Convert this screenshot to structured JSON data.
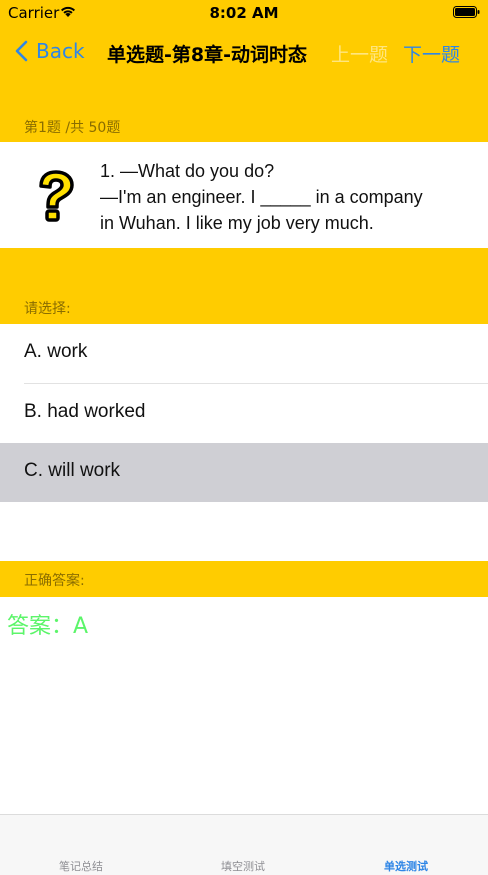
{
  "status_bar": {
    "carrier": "Carrier",
    "time": "8:02 AM"
  },
  "nav": {
    "back_label": "Back",
    "title": "单选题-第8章-动词时态",
    "prev_label": "上一题",
    "next_label": "下一题"
  },
  "progress": {
    "text": "第1题 /共 50题"
  },
  "question": {
    "lines": [
      "1. —What do you do?",
      "—I'm an engineer. I _____ in a company",
      "in Wuhan. I like my job very much."
    ]
  },
  "choose_label": "请选择:",
  "options": [
    {
      "label": "A. work",
      "selected": false
    },
    {
      "label": "B. had worked",
      "selected": false
    },
    {
      "label": "C. will work",
      "selected": true
    }
  ],
  "answer": {
    "header": "正确答案:",
    "text": "答案：A"
  },
  "tabs": [
    {
      "label": "笔记总结",
      "active": false
    },
    {
      "label": "填空测试",
      "active": false
    },
    {
      "label": "单选测试",
      "active": true
    }
  ],
  "colors": {
    "accent_yellow": "#FFCC00",
    "link_blue": "#2F86E6",
    "answer_green": "#5CF56A",
    "selected_gray": "#CFCFD4"
  }
}
